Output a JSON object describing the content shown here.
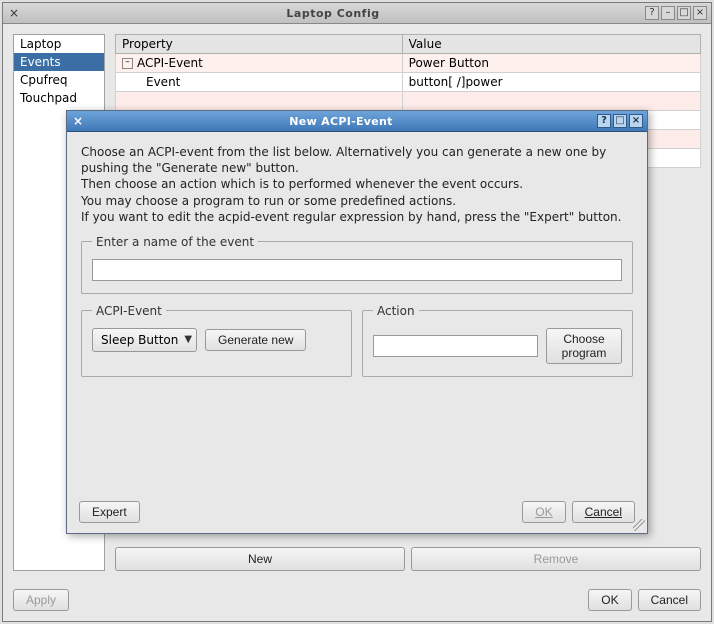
{
  "window": {
    "title": "Laptop Config",
    "help_glyph": "?",
    "min_glyph": "–",
    "max_glyph": "□",
    "close_glyph": "×"
  },
  "sidebar": {
    "items": [
      {
        "label": "Laptop"
      },
      {
        "label": "Events"
      },
      {
        "label": "Cpufreq"
      },
      {
        "label": "Touchpad"
      }
    ],
    "selected_index": 1
  },
  "table": {
    "headers": [
      "Property",
      "Value"
    ],
    "rows": [
      {
        "indent": 0,
        "toggle": "–",
        "prop": "ACPI-Event",
        "val": "Power Button",
        "cls": "rootrow"
      },
      {
        "indent": 1,
        "toggle": "",
        "prop": "Event",
        "val": "button[ /]power",
        "cls": ""
      },
      {
        "indent": 1,
        "toggle": "",
        "prop": "",
        "val": "",
        "cls": "pinkrow"
      },
      {
        "indent": 1,
        "toggle": "",
        "prop": "",
        "val": "",
        "cls": ""
      },
      {
        "indent": 1,
        "toggle": "",
        "prop": "",
        "val": "",
        "cls": "pinkrow"
      },
      {
        "indent": 1,
        "toggle": "",
        "prop": "",
        "val": "",
        "cls": ""
      }
    ]
  },
  "buttons": {
    "new": "New",
    "remove": "Remove",
    "apply": "Apply",
    "ok": "OK",
    "cancel": "Cancel"
  },
  "dialog": {
    "title": "New ACPI-Event",
    "intro_l1": "Choose an ACPI-event from the list below. Alternatively you can generate a new one by pushing the \"Generate new\" button.",
    "intro_l2": "Then choose an action which is to performed whenever the event occurs.",
    "intro_l3": "You may choose a program to run or some predefined actions.",
    "intro_l4": "If you want to edit the acpid-event regular expression by hand, press the \"Expert\" button.",
    "name_legend": "Enter a name of the event",
    "acpi_legend": "ACPI-Event",
    "action_legend": "Action",
    "combo_value": "Sleep Button",
    "generate_label": "Generate new",
    "choose_label": "Choose program",
    "expert_label": "Expert",
    "ok_label": "OK",
    "cancel_label": "Cancel",
    "help_glyph": "?",
    "max_glyph": "□",
    "close_glyph": "×",
    "close_left_glyph": "×"
  }
}
